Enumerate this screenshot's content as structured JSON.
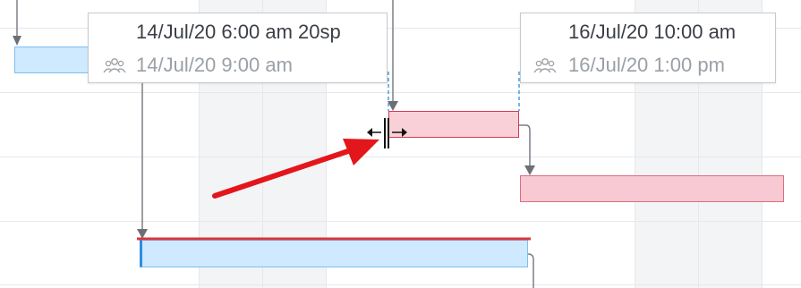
{
  "tooltips": {
    "start": {
      "planned_start": "14/Jul/20 6:00 am 20sp",
      "resource_start": "14/Jul/20 9:00 am",
      "icon": "team-icon"
    },
    "end": {
      "planned_end": "16/Jul/20 10:00 am",
      "resource_end": "16/Jul/20 1:00 pm",
      "icon": "team-icon"
    }
  },
  "colors": {
    "task_blue": "#cfe9ff",
    "task_pink": "#f7c9d2",
    "critical_red": "#d9363e",
    "arrow_red": "#e3161b",
    "dependency_gray": "#7b7f85"
  },
  "cursor": "resize-horizontal-cursor"
}
